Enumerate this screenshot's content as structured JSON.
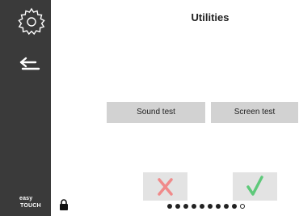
{
  "page": {
    "title": "Utilities"
  },
  "sidebar": {
    "icons": [
      "gear-icon",
      "back-arrow-icon"
    ],
    "brand_line1": "easy",
    "brand_line2": "TOUCH"
  },
  "buttons": {
    "sound_test": "Sound test",
    "screen_test": "Screen test"
  },
  "actions": {
    "cancel_icon": "x-icon",
    "confirm_icon": "checkmark-icon"
  },
  "pager": {
    "total": 10,
    "current": 10
  },
  "colors": {
    "sidebar": "#3a3a3a",
    "button_bg": "#d2d2d2",
    "tile_bg": "#e3e3e3",
    "cancel": "#f08a8a",
    "confirm": "#5ec97a"
  }
}
